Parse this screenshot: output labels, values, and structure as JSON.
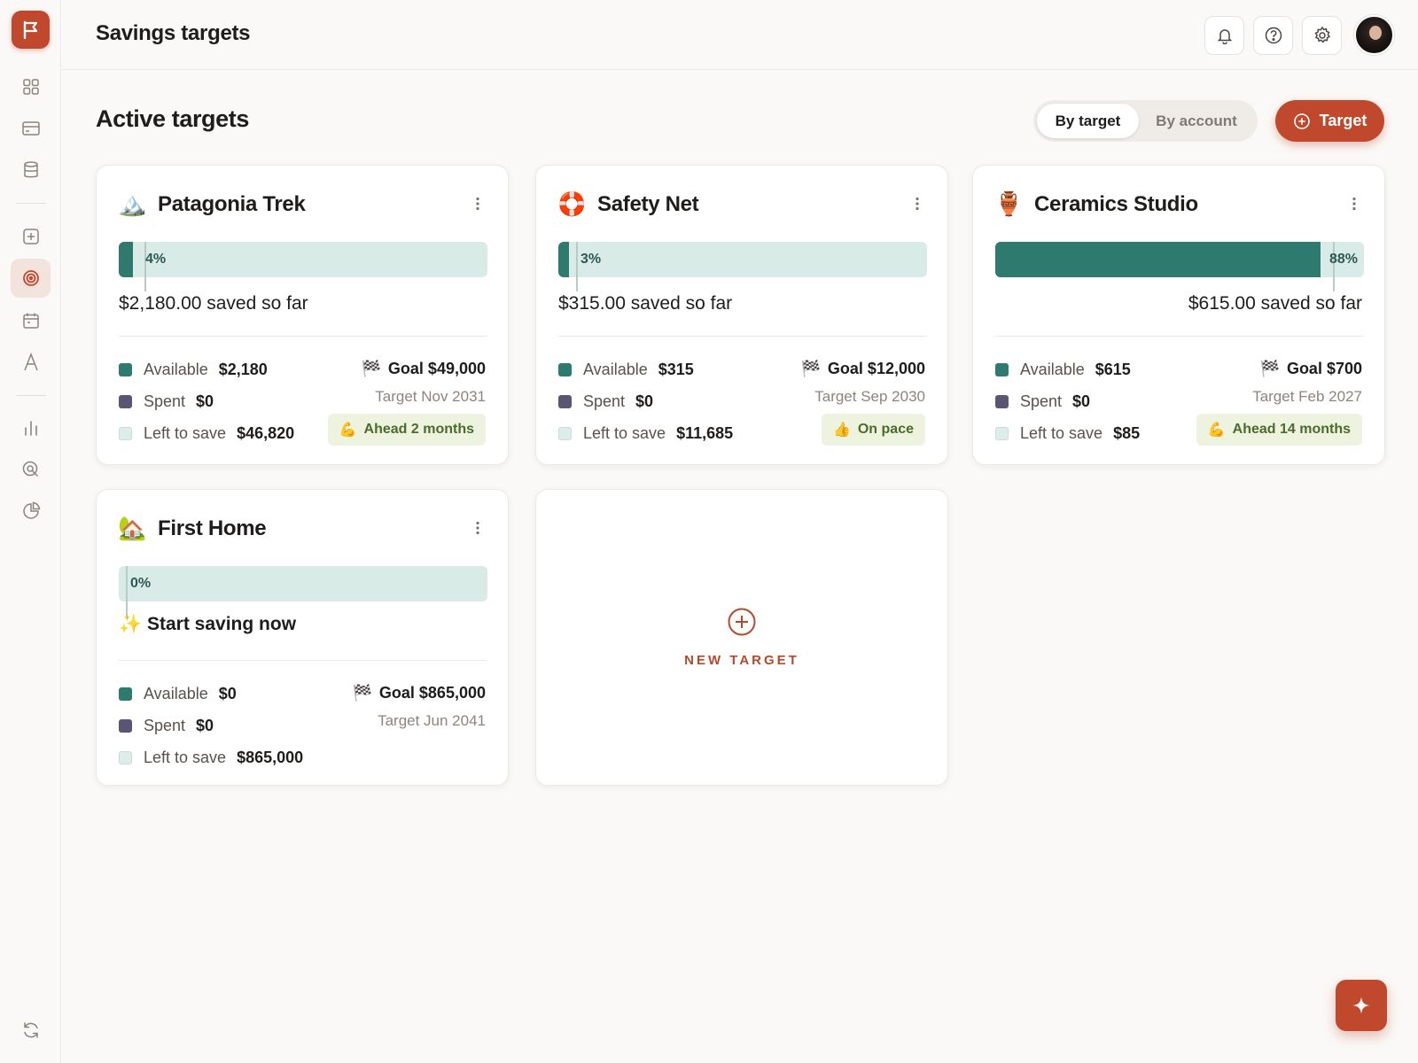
{
  "header": {
    "title": "Savings targets"
  },
  "section": {
    "title": "Active targets"
  },
  "view_toggle": {
    "by_target": "By target",
    "by_account": "By account",
    "selected": "By target"
  },
  "add_button": {
    "label": "Target"
  },
  "legend_labels": {
    "available": "Available",
    "spent": "Spent",
    "left": "Left to save"
  },
  "cards": [
    {
      "emoji": "🏔️",
      "title": "Patagonia Trek",
      "progress_label": "4%",
      "progress": 0.04,
      "saved_text": "$2,180.00 saved so far",
      "available": "$2,180",
      "spent": "$0",
      "left": "$46,820",
      "goal": "Goal $49,000",
      "target_date": "Target Nov 2031",
      "pace_emoji": "💪",
      "pace": "Ahead 2 months"
    },
    {
      "emoji": "🛟",
      "title": "Safety Net",
      "progress_label": "3%",
      "progress": 0.03,
      "saved_text": "$315.00 saved so far",
      "available": "$315",
      "spent": "$0",
      "left": "$11,685",
      "goal": "Goal $12,000",
      "target_date": "Target Sep 2030",
      "pace_emoji": "👍",
      "pace": "On pace"
    },
    {
      "emoji": "🏺",
      "title": "Ceramics Studio",
      "progress_label": "88%",
      "progress": 0.88,
      "saved_text": "$615.00 saved so far",
      "available": "$615",
      "spent": "$0",
      "left": "$85",
      "goal": "Goal $700",
      "target_date": "Target Feb 2027",
      "pace_emoji": "💪",
      "pace": "Ahead 14 months"
    },
    {
      "emoji": "🏡",
      "title": "First Home",
      "progress_label": "0%",
      "progress": 0,
      "saved_emoji": "✨",
      "saved_text": "Start saving now",
      "available": "$0",
      "spent": "$0",
      "left": "$865,000",
      "goal": "Goal $865,000",
      "target_date": "Target Jun 2041"
    }
  ],
  "goal_icon": "🏁",
  "new_target": {
    "label": "NEW TARGET"
  },
  "colors": {
    "accent": "#c0492d",
    "available": "#2f7a6f",
    "spent": "#5b5574",
    "left": "#ddeeea",
    "bar_bg": "#d9ebe7"
  },
  "icons": {
    "sidebar": [
      "grid-icon",
      "credit-card-icon",
      "database-icon",
      "plus-square-icon",
      "target-icon",
      "calendar-icon",
      "letter-a-icon",
      "bar-chart-icon",
      "search-zoom-icon",
      "pie-chart-icon",
      "refresh-icon"
    ],
    "header": [
      "bell-icon",
      "help-icon",
      "gear-icon"
    ]
  }
}
